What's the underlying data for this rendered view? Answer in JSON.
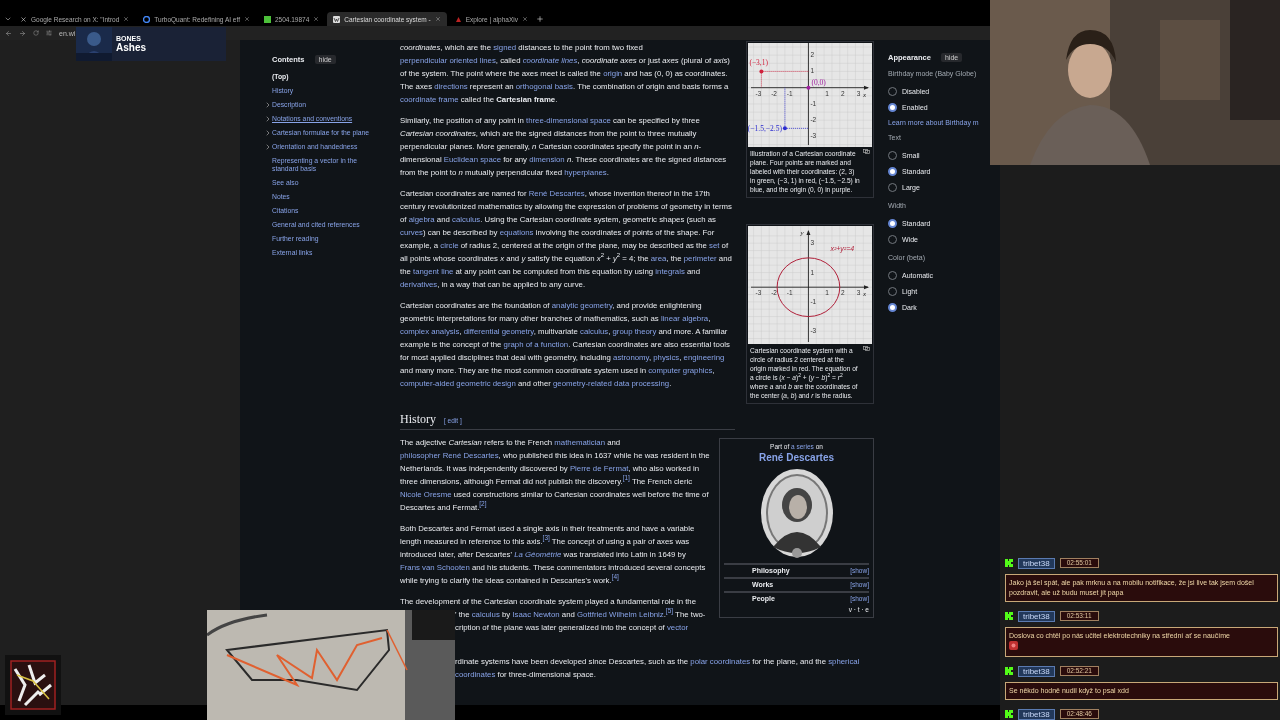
{
  "browser": {
    "tabs": [
      {
        "label": "Google Research on X: \"Introd",
        "selected": false
      },
      {
        "label": "TurboQuant: Redefining AI eff",
        "selected": false
      },
      {
        "label": "2504.19874",
        "selected": false
      },
      {
        "label": "Cartesian coordinate system -",
        "selected": true
      },
      {
        "label": "Explore | alphaXiv",
        "selected": false
      }
    ],
    "address": "en.wi"
  },
  "now_playing": {
    "artist": "BONES",
    "title": "Ashes"
  },
  "contents": {
    "title": "Contents",
    "hide": "hide",
    "items": [
      {
        "label": "(Top)",
        "expandable": false,
        "selected": true,
        "hovered": false
      },
      {
        "label": "History",
        "expandable": false,
        "selected": false,
        "hovered": false
      },
      {
        "label": "Description",
        "expandable": true,
        "selected": false,
        "hovered": false
      },
      {
        "label": "Notations and conventions",
        "expandable": true,
        "selected": false,
        "hovered": true
      },
      {
        "label": "Cartesian formulae for the plane",
        "expandable": true,
        "selected": false,
        "hovered": false
      },
      {
        "label": "Orientation and handedness",
        "expandable": true,
        "selected": false,
        "hovered": false
      },
      {
        "label": "Representing a vector in the standard basis",
        "expandable": false,
        "selected": false,
        "hovered": false
      },
      {
        "label": "See also",
        "expandable": false,
        "selected": false,
        "hovered": false
      },
      {
        "label": "Notes",
        "expandable": false,
        "selected": false,
        "hovered": false
      },
      {
        "label": "Citations",
        "expandable": false,
        "selected": false,
        "hovered": false
      },
      {
        "label": "General and cited references",
        "expandable": false,
        "selected": false,
        "hovered": false
      },
      {
        "label": "Further reading",
        "expandable": false,
        "selected": false,
        "hovered": false
      },
      {
        "label": "External links",
        "expandable": false,
        "selected": false,
        "hovered": false
      }
    ]
  },
  "intro": [
    [
      "*coordinates*, which are the ",
      {
        "link": "signed"
      },
      " distances to the point from two fixed ",
      {
        "link": "perpendicular oriented lines"
      },
      ", called ",
      {
        "link": "*coordinate lines*"
      },
      ", *coordinate axes* or just *axes* (plural of *axis*) of the system. The point where the axes meet is called the ",
      {
        "link": "origin"
      },
      " and has (0, 0) as coordinates. The axes ",
      {
        "link": "directions"
      },
      " represent an ",
      {
        "link": "orthogonal basis"
      },
      ". The combination of origin and basis forms a ",
      {
        "link": "coordinate frame"
      },
      " called the **Cartesian frame**."
    ],
    [
      "Similarly, the position of any point in ",
      {
        "link": "three-dimensional space"
      },
      " can be specified by three *Cartesian coordinates*, which are the signed distances from the point to three mutually perpendicular planes. More generally, *n* Cartesian coordinates specify the point in an *n*-dimensional ",
      {
        "link": "Euclidean space"
      },
      " for any ",
      {
        "link": "dimension"
      },
      " *n*. These coordinates are the signed distances from the point to *n* mutually perpendicular fixed ",
      {
        "link": "hyperplanes"
      },
      "."
    ],
    [
      "Cartesian coordinates are named for ",
      {
        "link": "René Descartes"
      },
      ", whose invention thereof in the 17th century revolutionized mathematics by allowing the expression of problems of geometry in terms of ",
      {
        "link": "algebra"
      },
      " and ",
      {
        "link": "calculus"
      },
      ". Using the Cartesian coordinate system, geometric shapes (such as ",
      {
        "link": "curves"
      },
      ") can be described by ",
      {
        "link": "equations"
      },
      " involving the coordinates of points of the shape. For example, a ",
      {
        "link": "circle"
      },
      " of radius 2, centered at the origin of the plane, may be described as the ",
      {
        "link": "set"
      },
      " of all points whose coordinates *x* and *y* satisfy the equation *x*$^{2}$ + *y*$^{2}$ = 4; the ",
      {
        "link": "area"
      },
      ", the ",
      {
        "link": "perimeter"
      },
      " and the ",
      {
        "link": "tangent line"
      },
      " at any point can be computed from this equation by using ",
      {
        "link": "integrals"
      },
      " and ",
      {
        "link": "derivatives"
      },
      ", in a way that can be applied to any curve."
    ],
    [
      "Cartesian coordinates are the foundation of ",
      {
        "link": "analytic geometry"
      },
      ", and provide enlightening geometric interpretations for many other branches of mathematics, such as ",
      {
        "link": "linear algebra"
      },
      ", ",
      {
        "link": "complex analysis"
      },
      ", ",
      {
        "link": "differential geometry"
      },
      ", multivariate ",
      {
        "link": "calculus"
      },
      ", ",
      {
        "link": "group theory"
      },
      " and more. A familiar example is the concept of the ",
      {
        "link": "graph of a function"
      },
      ". Cartesian coordinates are also essential tools for most applied disciplines that deal with geometry, including ",
      {
        "link": "astronomy"
      },
      ", ",
      {
        "link": "physics"
      },
      ", ",
      {
        "link": "engineering"
      },
      " and many more. They are the most common coordinate system used in ",
      {
        "link": "computer graphics"
      },
      ", ",
      {
        "link": "computer-aided geometric design"
      },
      " and other ",
      {
        "link": "geometry-related data processing"
      },
      "."
    ]
  ],
  "figures": [
    {
      "caption": "Illustration of a Cartesian coordinate plane. Four points are marked and labeled with their coordinates: (2, 3) in green, (−3, 1) in red, (−1.5, −2.5) in blue, and the origin (0, 0) in purple.",
      "drawing": {
        "kind": "points",
        "x_label": "x",
        "x_ticks": [
          "-3",
          "-2",
          "-1",
          "1",
          "2",
          "3"
        ],
        "y_ticks": [
          "2",
          "1",
          "-1",
          "-2",
          "-3"
        ],
        "points": [
          {
            "label": "(−3,1)",
            "color": "#d0203c"
          },
          {
            "label": "(−1.5,−2.5)",
            "color": "#2a2ad0"
          },
          {
            "label": "(0,0)",
            "color": "#a020a0"
          }
        ]
      }
    },
    {
      "caption": "Cartesian coordinate system with a circle of radius 2 centered at the origin marked in red. The equation of a circle is (*x* − *a*)$^{2}$ + (*y* − *b*)$^{2}$ = *r*$^{2}$ where *a* and *b* are the coordinates of the center (*a*, *b*) and *r* is the radius.",
      "drawing": {
        "kind": "circle",
        "x_label": "x",
        "y_label": "y",
        "x_ticks": [
          "-3",
          "-2",
          "-1",
          "1",
          "2",
          "3"
        ],
        "y_ticks": [
          "3",
          "1",
          "-1",
          "-3"
        ],
        "equation": "x²+y²=4"
      }
    }
  ],
  "history": {
    "title": "History",
    "edit": "[ edit ]",
    "paragraphs": [
      [
        "The adjective *Cartesian* refers to the French ",
        {
          "link": "mathematician"
        },
        " and ",
        {
          "link": "philosopher"
        },
        {
          "link": "René Descartes"
        },
        ", who published this idea in 1637 while he was resident in the Netherlands. It was independently discovered by ",
        {
          "link": "Pierre de Fermat"
        },
        ", who also worked in three dimensions, although Fermat did not publish the discovery.",
        {
          "link": "$^{[1]}$"
        },
        " The French cleric ",
        {
          "link": "Nicole Oresme"
        },
        " used constructions similar to Cartesian coordinates well before the time of Descartes and Fermat.",
        {
          "link": "$^{[2]}$"
        }
      ],
      [
        "Both Descartes and Fermat used a single axis in their treatments and have a variable length measured in reference to this axis.",
        {
          "link": "$^{[3]}$"
        },
        " The concept of using a pair of axes was introduced later, after Descartes' ",
        {
          "link": "*La Géométrie*"
        },
        " was translated into Latin in 1649 by ",
        {
          "link": "Frans van Schooten"
        },
        " and his students. These commentators introduced several concepts while trying to clarify the ideas contained in Descartes's work.",
        {
          "link": "$^{[4]}$"
        }
      ]
    ],
    "lines": [
      {
        "kind": "full",
        "runs": [
          "The development of the Cartesian coordinate system played a fundamental role in the"
        ]
      },
      {
        "kind": "covered",
        "runs": [
          "' the ",
          {
            "link": "calculus"
          },
          " by ",
          {
            "link": "Isaac Newton"
          },
          " and ",
          {
            "link": "Gottfried Wilhelm Leibniz"
          },
          ".",
          {
            "link": "$^{[5]}$"
          },
          " The two-"
        ]
      },
      {
        "kind": "covered",
        "runs": [
          "cription of the plane was later generalized into the concept of ",
          {
            "link": "vector"
          }
        ]
      }
    ],
    "more_lines": [
      {
        "kind": "covered-after-gap",
        "runs": [
          "rdinate systems have been developed since Descartes, such as the ",
          {
            "link": "polar coordinates"
          },
          " for the plane, and the ",
          {
            "link": "spherical"
          }
        ]
      },
      {
        "kind": "covered",
        "runs": [
          {
            "link": "coordinates"
          },
          " for three-dimensional space."
        ]
      }
    ]
  },
  "infobox": {
    "part_of": [
      "Part of ",
      {
        "link": "a series"
      },
      " on"
    ],
    "title": "René Descartes",
    "rows": [
      {
        "label": "Philosophy",
        "action": "[show]"
      },
      {
        "label": "Works",
        "action": "[show]"
      },
      {
        "label": "People",
        "action": "[show]"
      }
    ],
    "footer": "v · t · e"
  },
  "appearance": {
    "title": "Appearance",
    "hide": "hide",
    "groups": [
      {
        "label": "Birthday mode (Baby Globe)",
        "options": [
          {
            "label": "Disabled",
            "selected": false
          },
          {
            "label": "Enabled",
            "selected": true
          }
        ],
        "link": "Learn more about Birthday m"
      },
      {
        "label": "Text",
        "options": [
          {
            "label": "Small",
            "selected": false
          },
          {
            "label": "Standard",
            "selected": true
          },
          {
            "label": "Large",
            "selected": false
          }
        ]
      },
      {
        "label": "Width",
        "options": [
          {
            "label": "Standard",
            "selected": true
          },
          {
            "label": "Wide",
            "selected": false
          }
        ]
      },
      {
        "label": "Color (beta)",
        "options": [
          {
            "label": "Automatic",
            "selected": false
          },
          {
            "label": "Light",
            "selected": false
          },
          {
            "label": "Dark",
            "selected": true
          }
        ]
      }
    ]
  },
  "chat": [
    {
      "user": "tribet38",
      "time": "02:55:01",
      "message": "Jako já šel spát, ale pak mrknu a na mobilu notifikace, že jsi live tak jsem došel pozdravit, ale už budu muset jít papa",
      "emote": false
    },
    {
      "user": "tribet38",
      "time": "02:53:11",
      "message": "Doslova co chtěl po nás učitel elektrotechniky na střední ať se naučíme",
      "emote": true
    },
    {
      "user": "tribet38",
      "time": "02:52:21",
      "message": "Se někdo hodně nudil když to psal xdd",
      "emote": false
    },
    {
      "user": "tribet38",
      "time": "02:48:46"
    }
  ]
}
